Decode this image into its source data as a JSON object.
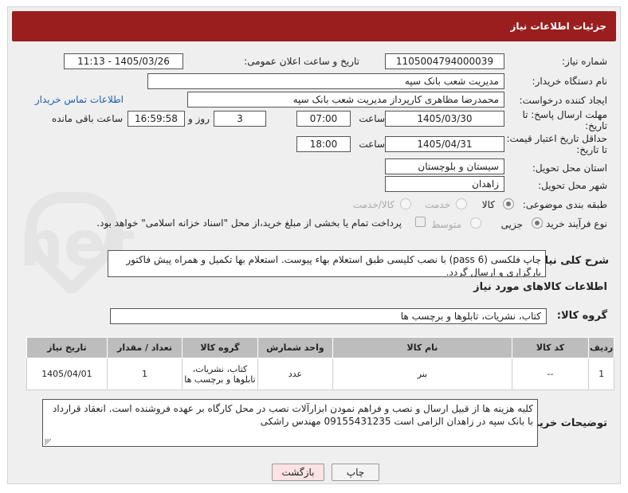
{
  "header": {
    "title": "جزئیات اطلاعات نیاز"
  },
  "form": {
    "need_number": {
      "label": "شماره نیاز:",
      "value": "1105004794000039"
    },
    "announce_datetime": {
      "label": "تاریخ و ساعت اعلان عمومی:",
      "value": "1405/03/26 - 11:13"
    },
    "buyer_org": {
      "label": "نام دستگاه خریدار:",
      "value": "مدیریت شعب بانک سپه"
    },
    "requester": {
      "label": "ایجاد کننده درخواست:",
      "value": "محمدرضا مظاهری کارپرداز مدیریت شعب بانک سپه",
      "contact_link": "اطلاعات تماس خریدار"
    },
    "response_deadline": {
      "label_line1": "مهلت ارسال پاسخ: تا",
      "label_line2": "تاریخ:",
      "date": "1405/03/30",
      "time_label": "ساعت",
      "time": "07:00",
      "days": "3",
      "days_label": "روز و",
      "remaining": "16:59:58",
      "remaining_label": "ساعت باقی مانده"
    },
    "price_validity": {
      "label_line1": "حداقل تاریخ اعتبار قیمت:",
      "label_line2": "تا تاریخ:",
      "date": "1405/04/31",
      "time_label": "ساعت",
      "time": "18:00"
    },
    "delivery_province": {
      "label": "استان محل تحویل:",
      "value": "سیستان و بلوچستان"
    },
    "delivery_city": {
      "label": "شهر محل تحویل:",
      "value": "زاهدان"
    },
    "category": {
      "label": "طبقه بندی موضوعی:",
      "options": [
        "کالا",
        "خدمت",
        "کالا/خدمت"
      ]
    },
    "purchase_process": {
      "label": "نوع فرآیند خرید :",
      "options": [
        "جزیی",
        "متوسط"
      ],
      "note": "پرداخت تمام یا بخشی از مبلغ خرید،از محل \"اسناد خزانه اسلامی\" خواهد بود."
    }
  },
  "summary": {
    "label": "شرح کلی نیاز:",
    "text": "چاپ فلکسی (pass 6) با نصب کلیسی طبق استعلام بهاء پیوست. استعلام بها تکمیل و همراه پیش فاکتور بارگزاری و ارسال گردد."
  },
  "goods": {
    "section_title": "اطلاعات کالاهای مورد نیاز",
    "group_label": "گروه کالا:",
    "group_value": "کتاب، نشریات، تابلوها و برچسب ها",
    "columns": [
      "ردیف",
      "کد کالا",
      "نام کالا",
      "واحد شمارش",
      "گروه کالا",
      "تعداد / مقدار",
      "تاریخ نیاز"
    ],
    "rows": [
      {
        "row": "1",
        "code": "--",
        "name": "بنر",
        "unit": "عدد",
        "group": "کتاب، نشریات، تابلوها و برچسب ها",
        "qty": "1",
        "date": "1405/04/01"
      }
    ]
  },
  "buyer_notes": {
    "label": "توضیحات خریدار:",
    "text": "کلیه هزینه ها از قبیل ارسال و نصب و فراهم نمودن ابزارآلات نصب در محل کارگاه بر عهده فروشنده است. انعقاد قرارداد با بانک سپه در زاهدان الزامی است 09155431235 مهندس راشکی"
  },
  "buttons": {
    "print": "چاپ",
    "back": "بازگشت"
  },
  "watermark": "AriaTender.net",
  "colors": {
    "header_bg": "#9a1e1e",
    "table_header_bg": "#bdbdbd",
    "link": "#1a5fb4",
    "back_button_bg": "#fbe3e3"
  }
}
